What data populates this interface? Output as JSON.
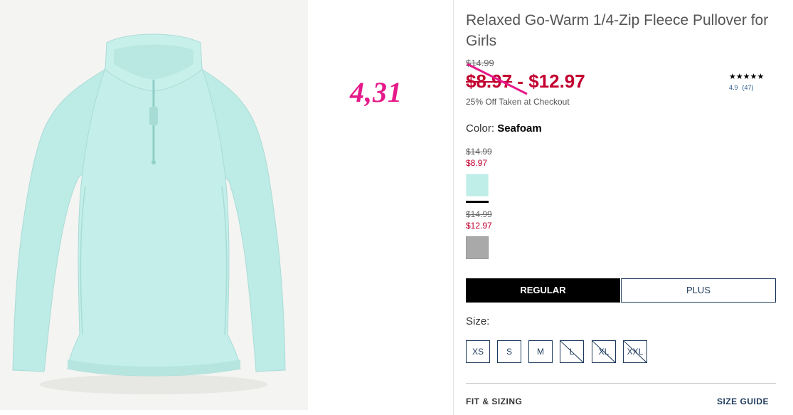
{
  "product": {
    "title": "Relaxed Go-Warm 1/4-Zip Fleece Pullover for Girls",
    "original_price": "$14.99",
    "sale_price_low": "$8.97",
    "price_separator": " - ",
    "sale_price_high": "$12.97",
    "promo_text": "25% Off Taken at Checkout",
    "stars": "★★★★★",
    "rating_value": "4.9",
    "review_count": "(47)"
  },
  "annotation": "4,31",
  "color": {
    "label": "Color:",
    "selected": "Seafoam",
    "swatches": [
      {
        "original_price": "$14.99",
        "price": "$8.97",
        "color": "#bfeee9",
        "name": "Seafoam"
      },
      {
        "original_price": "$14.99",
        "price": "$12.97",
        "color": "#a9a9a9",
        "name": "Grey"
      }
    ]
  },
  "fit": {
    "options": [
      "REGULAR",
      "PLUS"
    ],
    "selected": "REGULAR"
  },
  "size": {
    "label": "Size:",
    "options": [
      {
        "label": "XS",
        "available": true
      },
      {
        "label": "S",
        "available": true
      },
      {
        "label": "M",
        "available": true
      },
      {
        "label": "L",
        "available": false
      },
      {
        "label": "XL",
        "available": false
      },
      {
        "label": "XXL",
        "available": false
      }
    ]
  },
  "footer": {
    "fit_sizing": "FIT & SIZING",
    "size_guide": "SIZE GUIDE"
  },
  "colors": {
    "sale_red": "#c2002f",
    "link_navy": "#1d3a5c",
    "annotation_pink": "#e6198a",
    "garment": "#bdebe6"
  }
}
